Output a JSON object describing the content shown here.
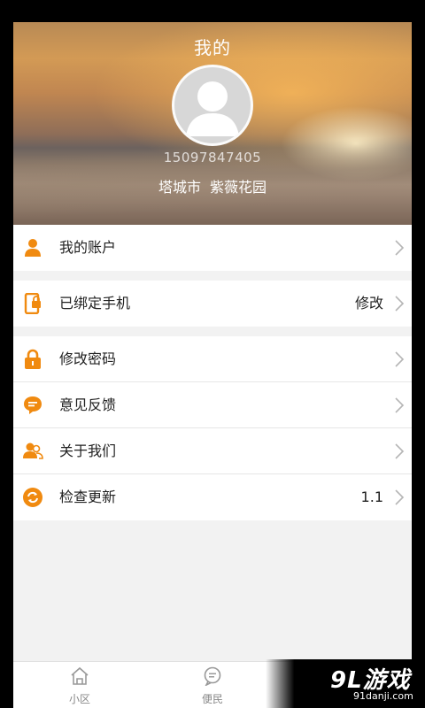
{
  "header": {
    "title": "我的",
    "phone": "15097847405",
    "city": "塔城市",
    "community": "紫薇花园"
  },
  "menu": {
    "account": {
      "label": "我的账户",
      "icon": "person-icon"
    },
    "phone": {
      "label": "已绑定手机",
      "value": "修改",
      "icon": "phone-lock-icon"
    },
    "password": {
      "label": "修改密码",
      "icon": "lock-icon"
    },
    "feedback": {
      "label": "意见反馈",
      "icon": "chat-bubble-icon"
    },
    "about": {
      "label": "关于我们",
      "icon": "people-icon"
    },
    "update": {
      "label": "检查更新",
      "value": "1.1",
      "icon": "refresh-icon"
    }
  },
  "tabbar": {
    "tabs": [
      {
        "label": "小区",
        "icon": "home-icon"
      },
      {
        "label": "便民",
        "icon": "message-icon"
      }
    ]
  },
  "watermark": {
    "brand": "9L游戏",
    "url": "91danji.com"
  },
  "colors": {
    "accent": "#f08a10",
    "background": "#f2f2f2",
    "text": "#222222"
  }
}
